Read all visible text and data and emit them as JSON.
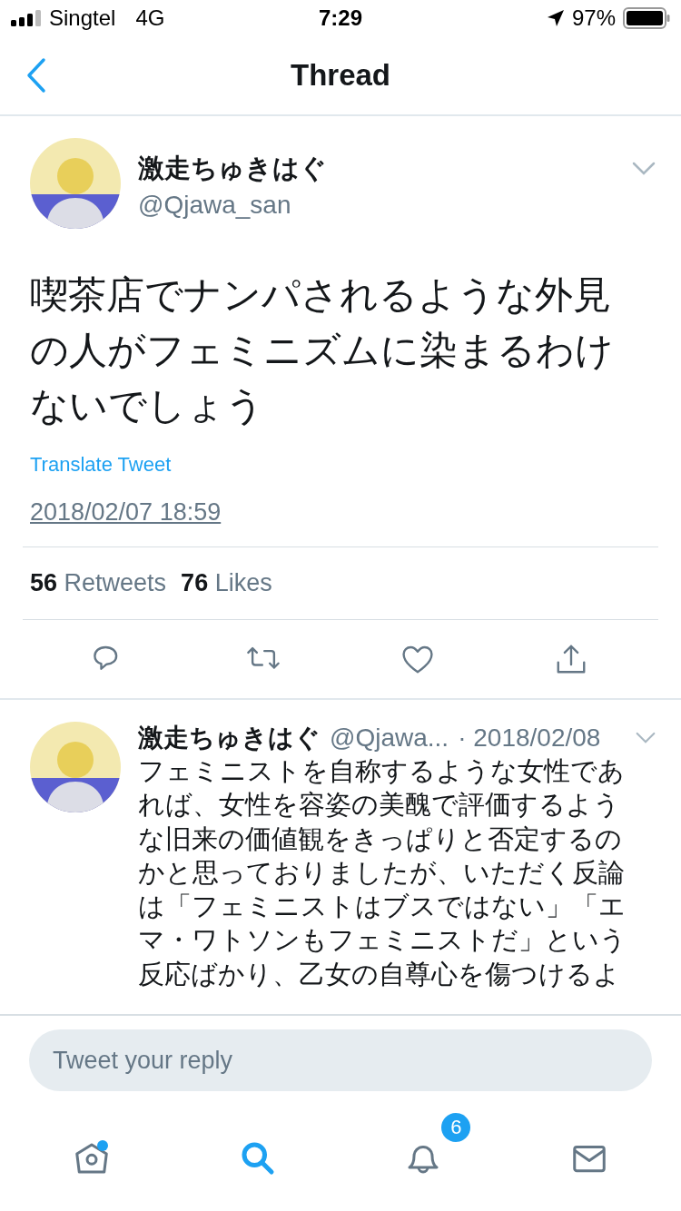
{
  "status_bar": {
    "carrier": "Singtel",
    "network": "4G",
    "time": "7:29",
    "battery": "97%"
  },
  "nav": {
    "title": "Thread"
  },
  "tweet": {
    "name": "激走ちゅきはぐ",
    "handle": "@Qjawa_san",
    "text_lines": [
      "喫茶店でナンパされるような外見",
      "の人がフェミニズムに染まるわけ",
      "ないでしょう"
    ],
    "translate": "Translate Tweet",
    "timestamp": "2018/02/07 18:59",
    "stats": [
      {
        "count": "56",
        "label": "Retweets"
      },
      {
        "count": "76",
        "label": "Likes"
      }
    ],
    "actions": [
      {
        "kind": "reply"
      },
      {
        "kind": "retweet"
      },
      {
        "kind": "like"
      },
      {
        "kind": "share"
      }
    ]
  },
  "reply": {
    "name": "激走ちゅきはぐ",
    "handle": "@Qjawa...",
    "date": "· 2018/02/08",
    "text_lines": [
      "フェミニストを自称するような女性であ",
      "れば、女性を容姿の美醜で評価するよう",
      "な旧来の価値観をきっぱりと否定するの",
      "かと思っておりましたが、いただく反論",
      "は「フェミニストはブスではない」「エ",
      "マ・ワトソンもフェミニストだ」という",
      "反応ばかり、乙女の自尊心を傷つけるよ"
    ]
  },
  "composer": {
    "placeholder": "Tweet your reply"
  },
  "tabs": [
    {
      "kind": "home",
      "selected": false,
      "dot": true
    },
    {
      "kind": "search",
      "selected": true,
      "dot": false
    },
    {
      "kind": "notifications",
      "selected": false,
      "dot": false,
      "badge": "6"
    },
    {
      "kind": "messages",
      "selected": false,
      "dot": false
    }
  ]
}
